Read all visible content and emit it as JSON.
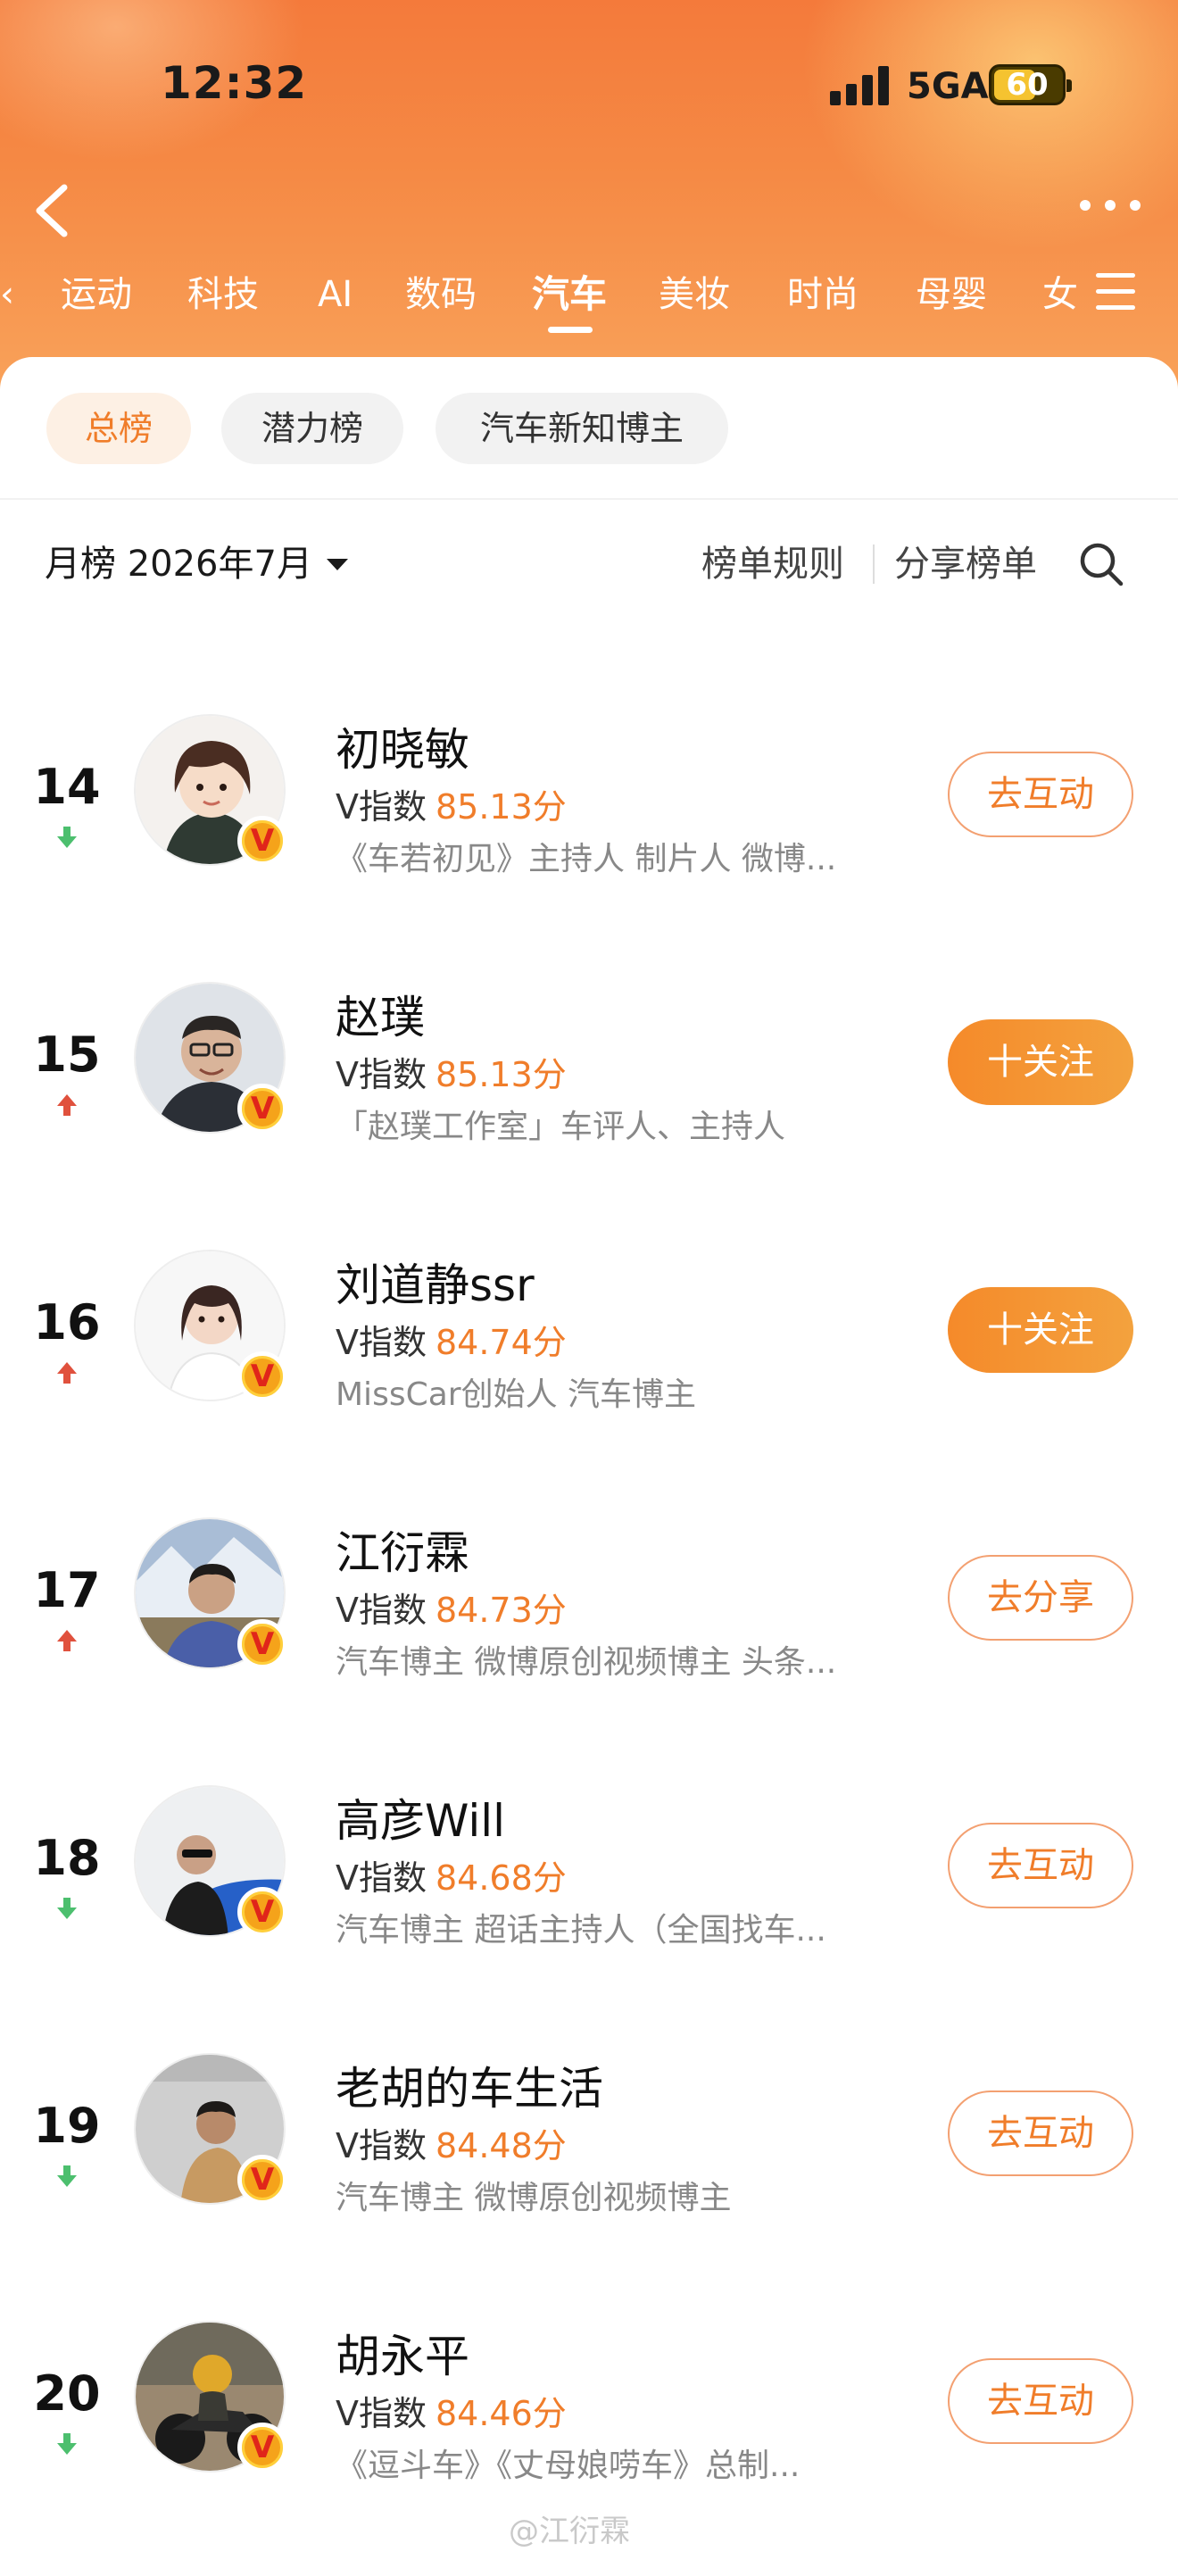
{
  "status_bar": {
    "time": "12:32",
    "network": "5GA",
    "battery": "60"
  },
  "icons": {
    "back": "back-icon",
    "more": "more-icon",
    "menu": "menu-icon",
    "search": "search-icon",
    "trend_up": "trend-up-icon",
    "trend_down": "trend-down-icon",
    "verified": "verified-v-icon"
  },
  "category_tabs": [
    {
      "label": "运动"
    },
    {
      "label": "科技"
    },
    {
      "label": "AI"
    },
    {
      "label": "数码"
    },
    {
      "label": "汽车",
      "active": true
    },
    {
      "label": "美妆"
    },
    {
      "label": "时尚"
    },
    {
      "label": "母婴"
    },
    {
      "label": "女"
    }
  ],
  "sub_tabs": [
    {
      "label": "总榜",
      "active": true
    },
    {
      "label": "潜力榜"
    },
    {
      "label": "汽车新知博主"
    }
  ],
  "filter": {
    "period": "月榜 2026年7月",
    "rules": "榜单规则",
    "share": "分享榜单"
  },
  "vindex_label": "V指数",
  "rankings": [
    {
      "rank": "14",
      "trend": "down",
      "name": "初晓敏",
      "score": "85.13分",
      "desc": "《车若初见》主持人 制片人 微博...",
      "action": "去互动",
      "action_style": "outline"
    },
    {
      "rank": "15",
      "trend": "up",
      "name": "赵璞",
      "score": "85.13分",
      "desc": "「赵璞工作室」车评人、主持人",
      "action": "十关注",
      "action_style": "filled"
    },
    {
      "rank": "16",
      "trend": "up",
      "name": "刘道静ssr",
      "score": "84.74分",
      "desc": "MissCar创始人 汽车博主",
      "action": "十关注",
      "action_style": "filled"
    },
    {
      "rank": "17",
      "trend": "up",
      "name": "江衍霖",
      "score": "84.73分",
      "desc": "汽车博主 微博原创视频博主 头条...",
      "action": "去分享",
      "action_style": "outline"
    },
    {
      "rank": "18",
      "trend": "down",
      "name": "高彦Will",
      "score": "84.68分",
      "desc": "汽车博主 超话主持人（全国找车...",
      "action": "去互动",
      "action_style": "outline"
    },
    {
      "rank": "19",
      "trend": "down",
      "name": "老胡的车生活",
      "score": "84.48分",
      "desc": "汽车博主 微博原创视频博主",
      "action": "去互动",
      "action_style": "outline"
    },
    {
      "rank": "20",
      "trend": "down",
      "name": "胡永平",
      "score": "84.46分",
      "desc": "《逗斗车》《丈母娘唠车》总制...",
      "action": "去互动",
      "action_style": "outline"
    }
  ],
  "watermark": "@江衍霖",
  "colors": {
    "accent": "#f07d2a",
    "header": "#f58a45",
    "trend_up": "#e0513d",
    "trend_down": "#4cbf6e"
  }
}
